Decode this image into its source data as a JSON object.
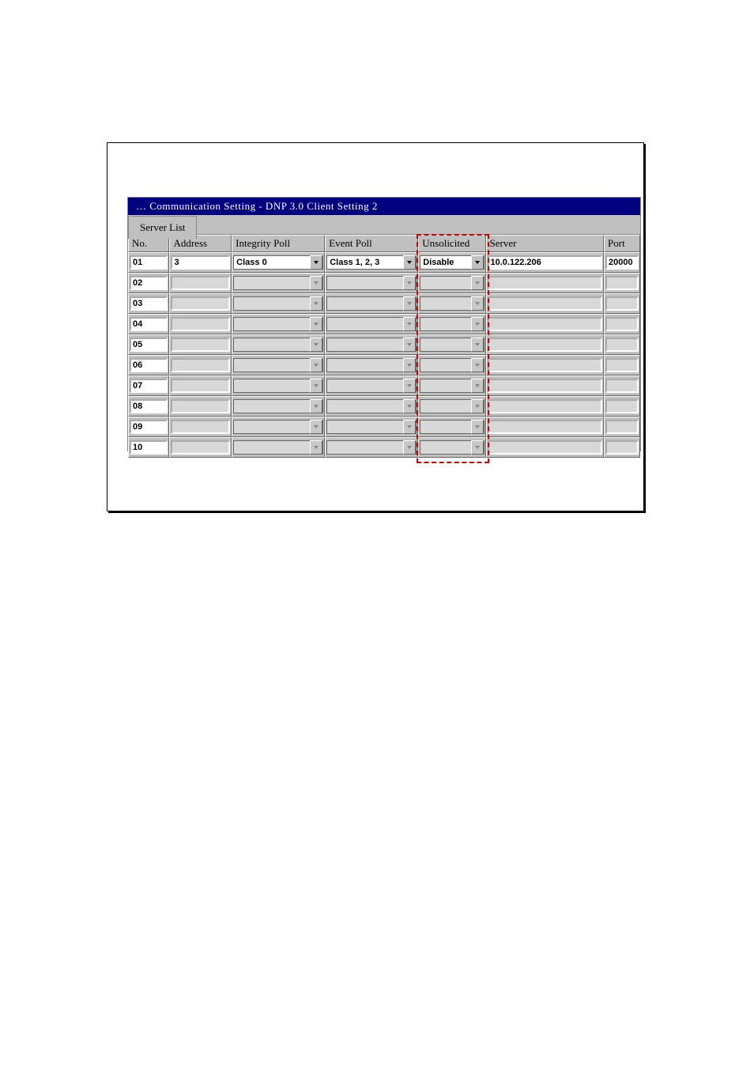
{
  "window": {
    "title": "… Communication Setting - DNP 3.0 Client Setting 2"
  },
  "tab": {
    "label": "Server List"
  },
  "columns": {
    "no": "No.",
    "address": "Address",
    "integrity_poll": "Integrity Poll",
    "event_poll": "Event Poll",
    "unsolicited": "Unsolicited",
    "server": "Server",
    "port": "Port"
  },
  "rows": [
    {
      "no": "01",
      "address": "3",
      "integrity": "Class 0",
      "event": "Class 1, 2, 3",
      "unsol": "Disable",
      "server": "10.0.122.206",
      "port": "20000",
      "enabled": true
    },
    {
      "no": "02",
      "address": "",
      "integrity": "",
      "event": "",
      "unsol": "",
      "server": "",
      "port": "",
      "enabled": false
    },
    {
      "no": "03",
      "address": "",
      "integrity": "",
      "event": "",
      "unsol": "",
      "server": "",
      "port": "",
      "enabled": false
    },
    {
      "no": "04",
      "address": "",
      "integrity": "",
      "event": "",
      "unsol": "",
      "server": "",
      "port": "",
      "enabled": false
    },
    {
      "no": "05",
      "address": "",
      "integrity": "",
      "event": "",
      "unsol": "",
      "server": "",
      "port": "",
      "enabled": false
    },
    {
      "no": "06",
      "address": "",
      "integrity": "",
      "event": "",
      "unsol": "",
      "server": "",
      "port": "",
      "enabled": false
    },
    {
      "no": "07",
      "address": "",
      "integrity": "",
      "event": "",
      "unsol": "",
      "server": "",
      "port": "",
      "enabled": false
    },
    {
      "no": "08",
      "address": "",
      "integrity": "",
      "event": "",
      "unsol": "",
      "server": "",
      "port": "",
      "enabled": false
    },
    {
      "no": "09",
      "address": "",
      "integrity": "",
      "event": "",
      "unsol": "",
      "server": "",
      "port": "",
      "enabled": false
    },
    {
      "no": "10",
      "address": "",
      "integrity": "",
      "event": "",
      "unsol": "",
      "server": "",
      "port": "",
      "enabled": false
    }
  ]
}
